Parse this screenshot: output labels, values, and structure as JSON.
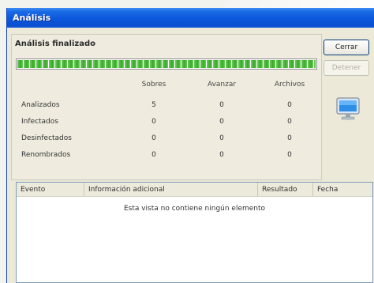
{
  "window": {
    "title": "Análisis"
  },
  "analysis": {
    "title": "Análisis finalizado",
    "progress": 1.0,
    "columns": [
      "Sobres",
      "Avanzar",
      "Archivos"
    ],
    "rows": [
      {
        "label": "Analizados",
        "values": [
          "5",
          "0",
          "0"
        ]
      },
      {
        "label": "Infectados",
        "values": [
          "0",
          "0",
          "0"
        ]
      },
      {
        "label": "Desinfectados",
        "values": [
          "0",
          "0",
          "0"
        ]
      },
      {
        "label": "Renombrados",
        "values": [
          "0",
          "0",
          "0"
        ]
      }
    ]
  },
  "buttons": {
    "primary": "Cerrar",
    "secondary": "Detener"
  },
  "icon": {
    "monitor": "monitor-icon"
  },
  "results": {
    "columns": [
      "Evento",
      "Información adicional",
      "Resultado",
      "Fecha"
    ],
    "empty_message": "Esta vista no contiene ningún elemento"
  },
  "colors": {
    "titlebar": "#0c58dc",
    "progress": "#37a72a",
    "window": "#ece9d8"
  }
}
